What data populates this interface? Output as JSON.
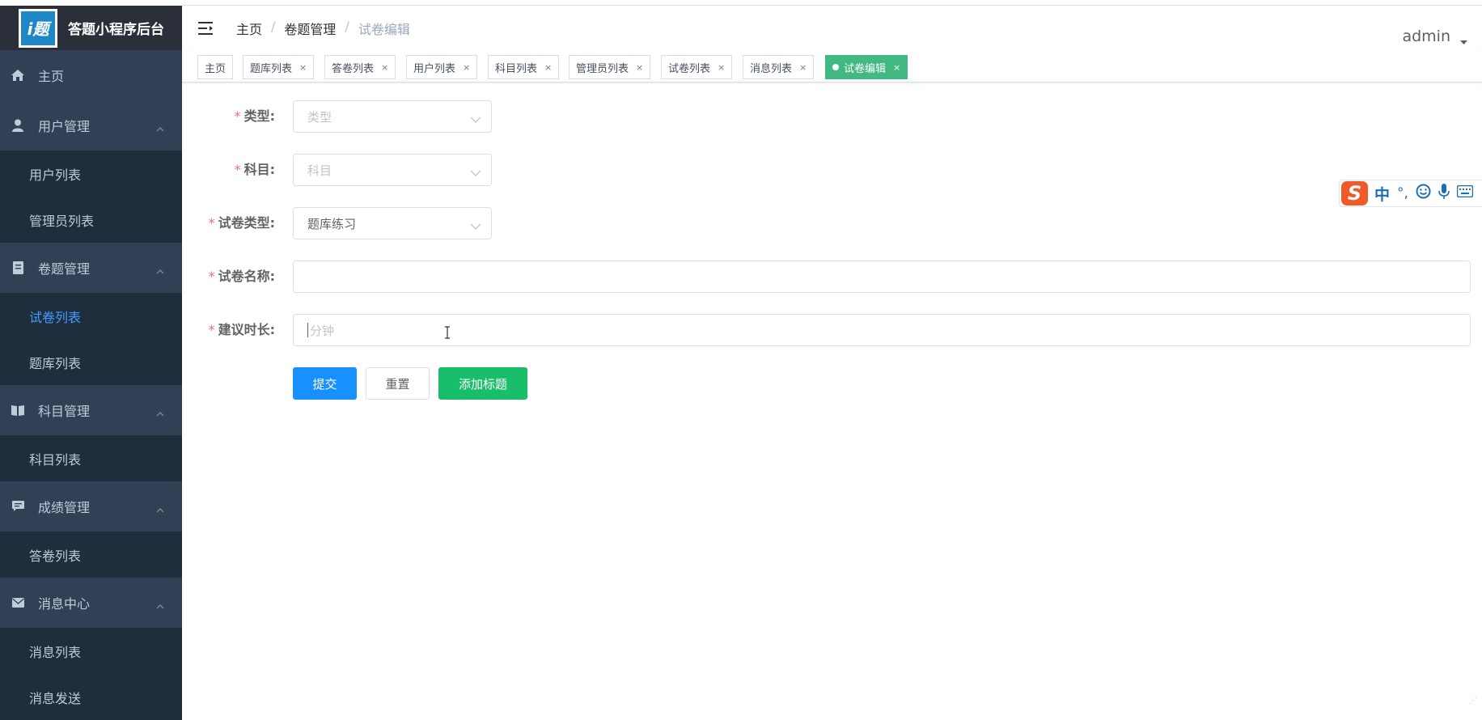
{
  "app": {
    "title": "答题小程序后台",
    "logo_text": "i题"
  },
  "sidebar": {
    "home": "主页",
    "groups": [
      {
        "label": "用户管理",
        "items": [
          "用户列表",
          "管理员列表"
        ]
      },
      {
        "label": "卷题管理",
        "items": [
          "试卷列表",
          "题库列表"
        ]
      },
      {
        "label": "科目管理",
        "items": [
          "科目列表"
        ]
      },
      {
        "label": "成绩管理",
        "items": [
          "答卷列表"
        ]
      },
      {
        "label": "消息中心",
        "items": [
          "消息列表",
          "消息发送"
        ]
      }
    ],
    "active_item": "试卷列表"
  },
  "header": {
    "breadcrumb": [
      "主页",
      "卷题管理",
      "试卷编辑"
    ],
    "user": "admin"
  },
  "tags": [
    {
      "label": "主页",
      "closable": false
    },
    {
      "label": "题库列表",
      "closable": true
    },
    {
      "label": "答卷列表",
      "closable": true
    },
    {
      "label": "用户列表",
      "closable": true
    },
    {
      "label": "科目列表",
      "closable": true
    },
    {
      "label": "管理员列表",
      "closable": true
    },
    {
      "label": "试卷列表",
      "closable": true
    },
    {
      "label": "消息列表",
      "closable": true
    },
    {
      "label": "试卷编辑",
      "closable": true,
      "active": true
    }
  ],
  "form": {
    "type": {
      "label": "类型:",
      "placeholder": "类型"
    },
    "subject": {
      "label": "科目:",
      "placeholder": "科目"
    },
    "paper_type": {
      "label": "试卷类型:",
      "value": "题库练习"
    },
    "paper_name": {
      "label": "试卷名称:",
      "value": ""
    },
    "duration": {
      "label": "建议时长:",
      "placeholder": "分钟"
    },
    "buttons": {
      "submit": "提交",
      "reset": "重置",
      "add_title": "添加标题"
    }
  },
  "ime": {
    "mode": "中",
    "punct": "°,"
  },
  "colors": {
    "sidebar_bg": "#304156",
    "active": "#409eff",
    "tag_active": "#42b983",
    "primary": "#1890ff",
    "success": "#19be6b",
    "required": "#f56c6c"
  }
}
